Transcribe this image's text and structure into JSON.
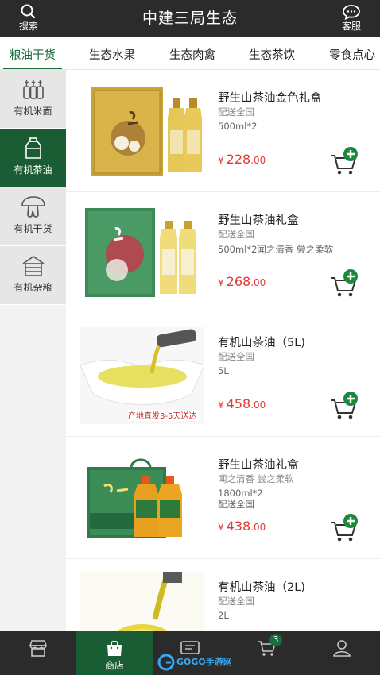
{
  "header": {
    "title": "中建三局生态",
    "search_label": "搜索",
    "service_label": "客服"
  },
  "tabs": [
    {
      "label": "粮油干货",
      "active": true
    },
    {
      "label": "生态水果",
      "active": false
    },
    {
      "label": "生态肉禽",
      "active": false
    },
    {
      "label": "生态茶饮",
      "active": false
    },
    {
      "label": "零食点心",
      "active": false
    }
  ],
  "sidebar": [
    {
      "label": "有机米面",
      "icon": "rice-flour-icon",
      "active": false
    },
    {
      "label": "有机茶油",
      "icon": "oil-bottle-icon",
      "active": true
    },
    {
      "label": "有机干货",
      "icon": "mushroom-icon",
      "active": false
    },
    {
      "label": "有机杂粮",
      "icon": "granary-icon",
      "active": false
    }
  ],
  "products": [
    {
      "name": "野生山茶油金色礼盒",
      "lines": [
        "配送全国",
        "500ml*2"
      ],
      "price_currency": "¥",
      "price_int": "228",
      "price_dec": ".00",
      "image": "gold-gift-box-with-two-oil-bottles"
    },
    {
      "name": "野生山茶油礼盒",
      "lines": [
        "配送全国",
        "500ml*2闻之清香 尝之柔软"
      ],
      "price_currency": "¥",
      "price_int": "268",
      "price_dec": ".00",
      "image": "green-gift-box-with-two-oil-bottles"
    },
    {
      "name": "有机山茶油（5L)",
      "lines": [
        "配送全国",
        "5L"
      ],
      "price_currency": "¥",
      "price_int": "458",
      "price_dec": ".00",
      "image": "oil-pouring-into-white-bowl",
      "image_caption": "产地直发3-5天送达"
    },
    {
      "name": "野生山茶油礼盒",
      "lines": [
        "闻之清香 尝之柔软",
        "1800ml*2",
        "配送全国"
      ],
      "price_currency": "¥",
      "price_int": "438",
      "price_dec": ".00",
      "image": "green-box-with-two-large-oil-jugs"
    },
    {
      "name": "有机山茶油（2L)",
      "lines": [
        "配送全国",
        "2L"
      ],
      "price_currency": "¥",
      "price_int": "",
      "price_dec": "",
      "image": "oil-pouring-closeup"
    }
  ],
  "bottom_nav": [
    {
      "label": "",
      "icon": "home-icon",
      "active": false
    },
    {
      "label": "商店",
      "icon": "shop-bag-icon",
      "active": true
    },
    {
      "label": "",
      "icon": "message-icon",
      "active": false
    },
    {
      "label": "",
      "icon": "cart-icon",
      "active": false,
      "badge": "3"
    },
    {
      "label": "",
      "icon": "user-icon",
      "active": false
    }
  ],
  "watermark": {
    "text": "GOGO手游网"
  },
  "colors": {
    "header_bg": "#2b2b2b",
    "accent_green": "#1a5c34",
    "tab_active": "#1a6b3a",
    "price_red": "#e53935",
    "add_badge_green": "#1a8a3a"
  }
}
